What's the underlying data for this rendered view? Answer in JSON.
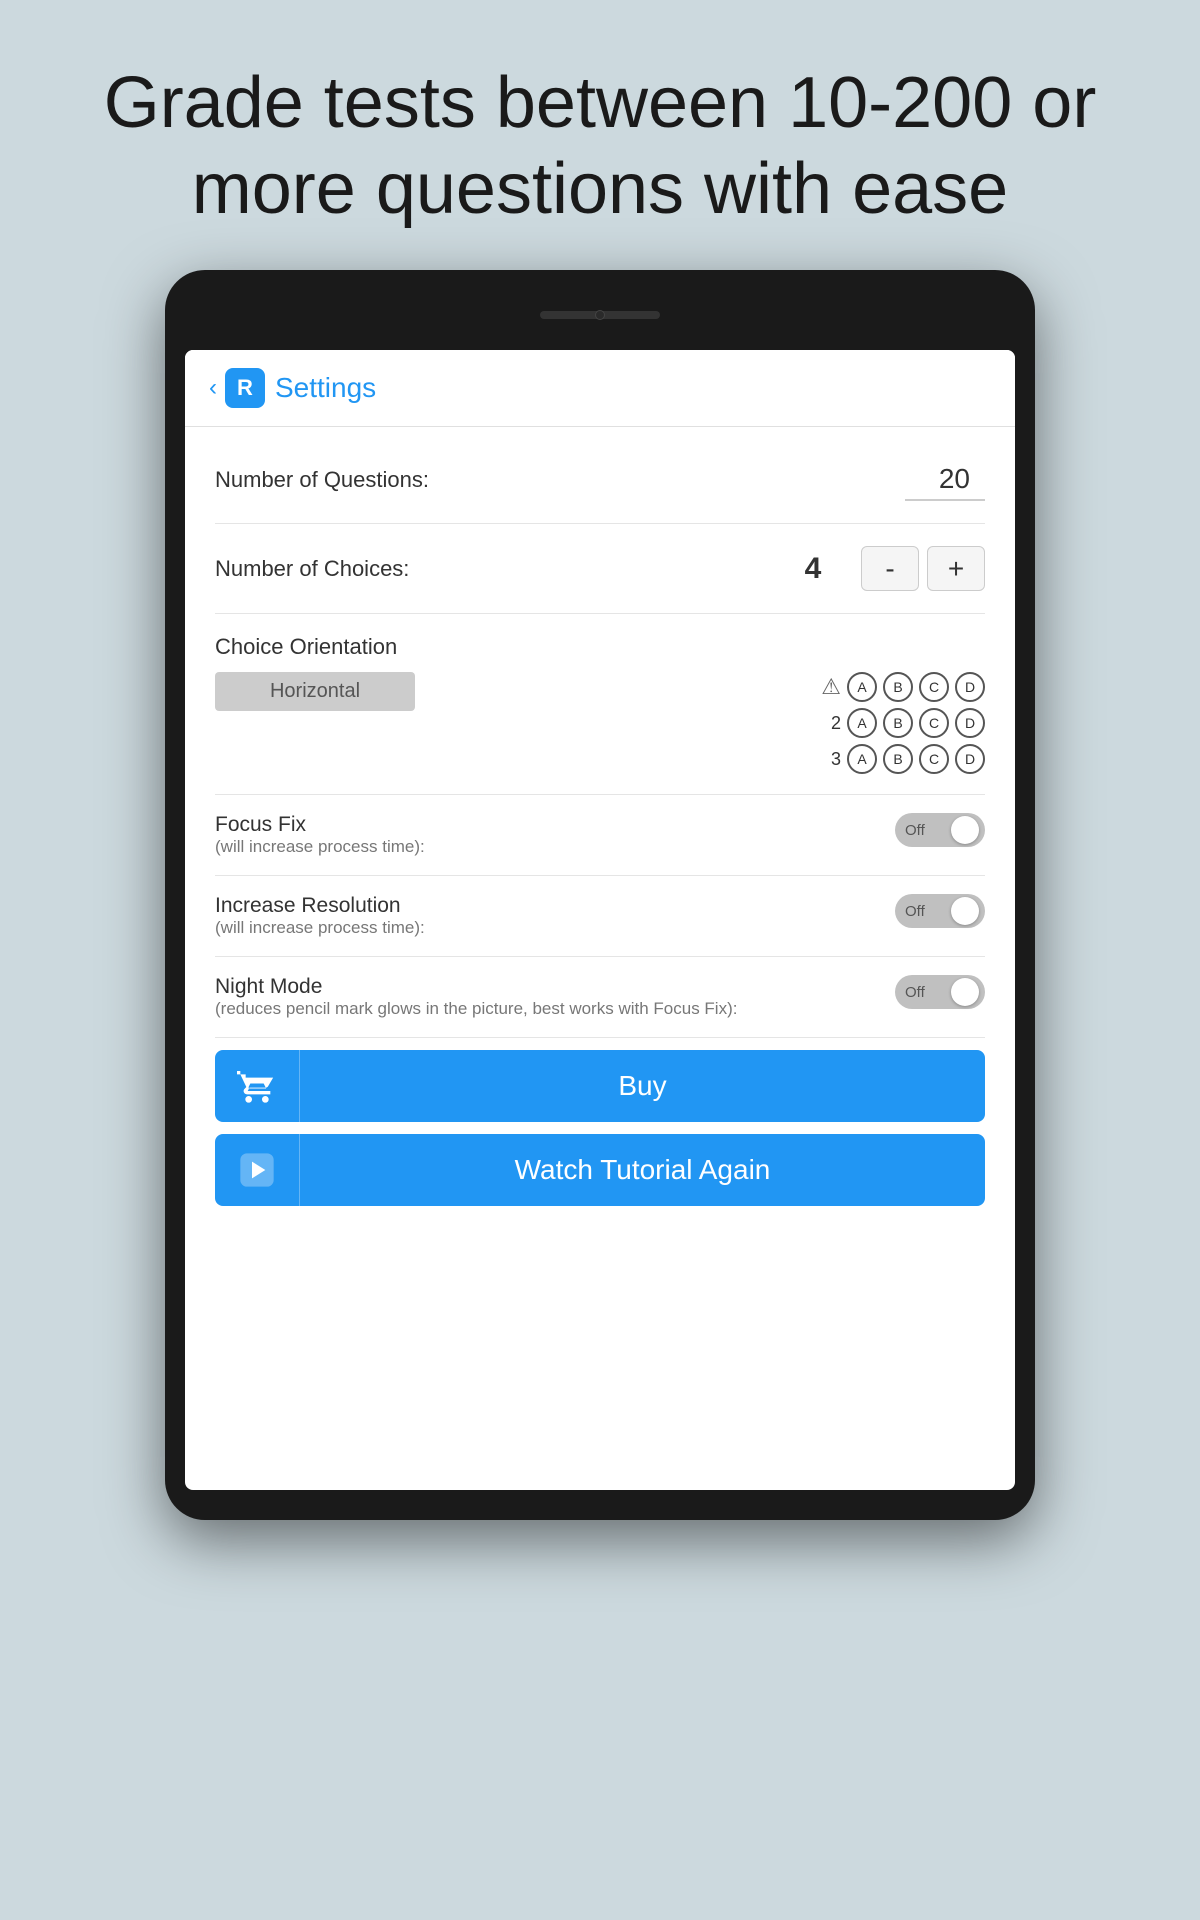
{
  "headline": {
    "line1": "Grade tests between 10-200 or",
    "line2": "more questions with ease"
  },
  "app": {
    "logo_letter": "R",
    "title": "Settings",
    "back_label": "‹"
  },
  "settings": {
    "number_of_questions_label": "Number of Questions:",
    "number_of_questions_value": "20",
    "number_of_choices_label": "Number of Choices:",
    "number_of_choices_value": "4",
    "minus_label": "-",
    "plus_label": "+",
    "choice_orientation_label": "Choice Orientation",
    "horizontal_btn_label": "Horizontal",
    "focus_fix_label": "Focus Fix",
    "focus_fix_sub": "(will increase process time):",
    "focus_fix_state": "Off",
    "increase_resolution_label": "Increase Resolution",
    "increase_resolution_sub": "(will increase process time):",
    "increase_resolution_state": "Off",
    "night_mode_label": "Night Mode",
    "night_mode_sub": "(reduces pencil mark glows in the picture, best works with Focus Fix):",
    "night_mode_state": "Off"
  },
  "buttons": {
    "buy_label": "Buy",
    "tutorial_label": "Watch Tutorial Again"
  },
  "choice_preview": {
    "rows": [
      {
        "num": "",
        "is_warning": true,
        "choices": [
          "A",
          "B",
          "C",
          "D"
        ]
      },
      {
        "num": "2",
        "is_warning": false,
        "choices": [
          "A",
          "B",
          "C",
          "D"
        ]
      },
      {
        "num": "3",
        "is_warning": false,
        "choices": [
          "A",
          "B",
          "C",
          "D"
        ]
      }
    ]
  }
}
